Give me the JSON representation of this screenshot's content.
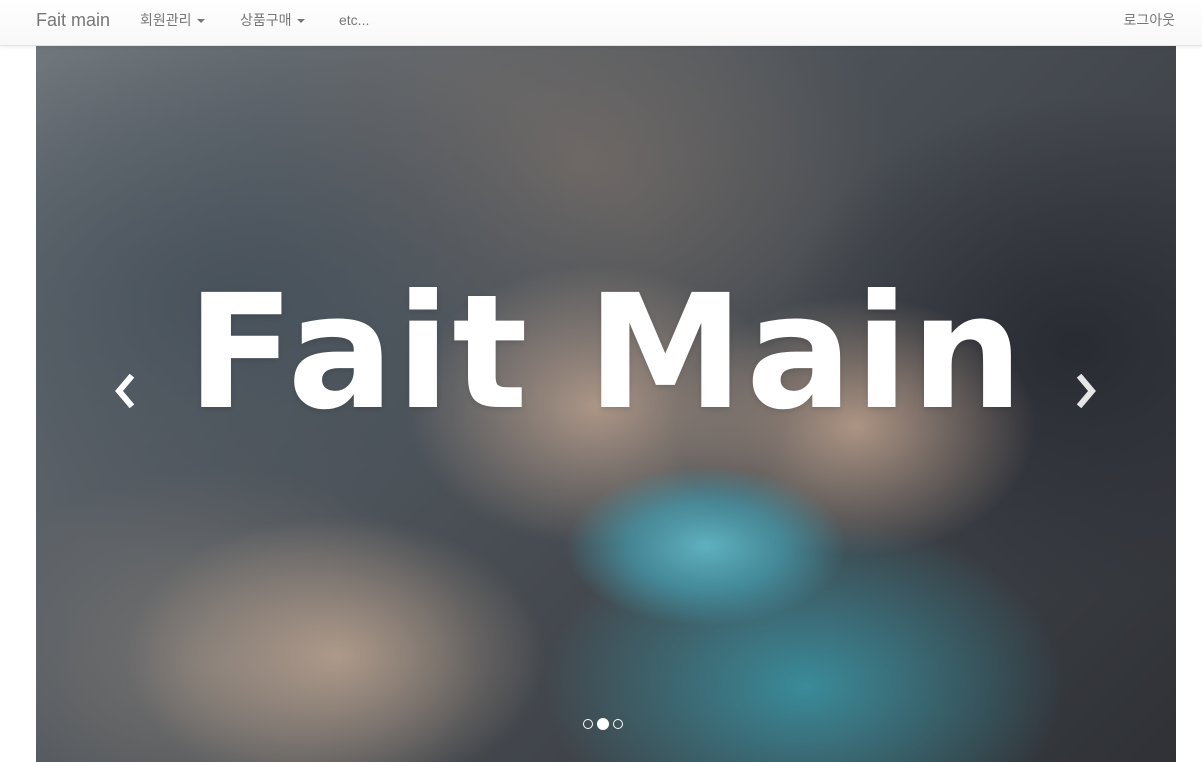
{
  "navbar": {
    "brand": "Fait main",
    "items": [
      {
        "label": "회원관리",
        "has_dropdown": true
      },
      {
        "label": "상품구매",
        "has_dropdown": true
      },
      {
        "label": "etc...",
        "has_dropdown": false
      }
    ],
    "logout_label": "로그아웃"
  },
  "carousel": {
    "slide_title": "Fait Main",
    "image_subject": "hands knitting teal yarn",
    "indicator_count": 3,
    "active_index": 1,
    "prev_icon": "chevron-left-icon",
    "next_icon": "chevron-right-icon"
  },
  "colors": {
    "nav_text": "#777777",
    "nav_bg": "#f8f8f8",
    "hero_text": "#ffffff",
    "yarn": "#5fb4c4"
  }
}
